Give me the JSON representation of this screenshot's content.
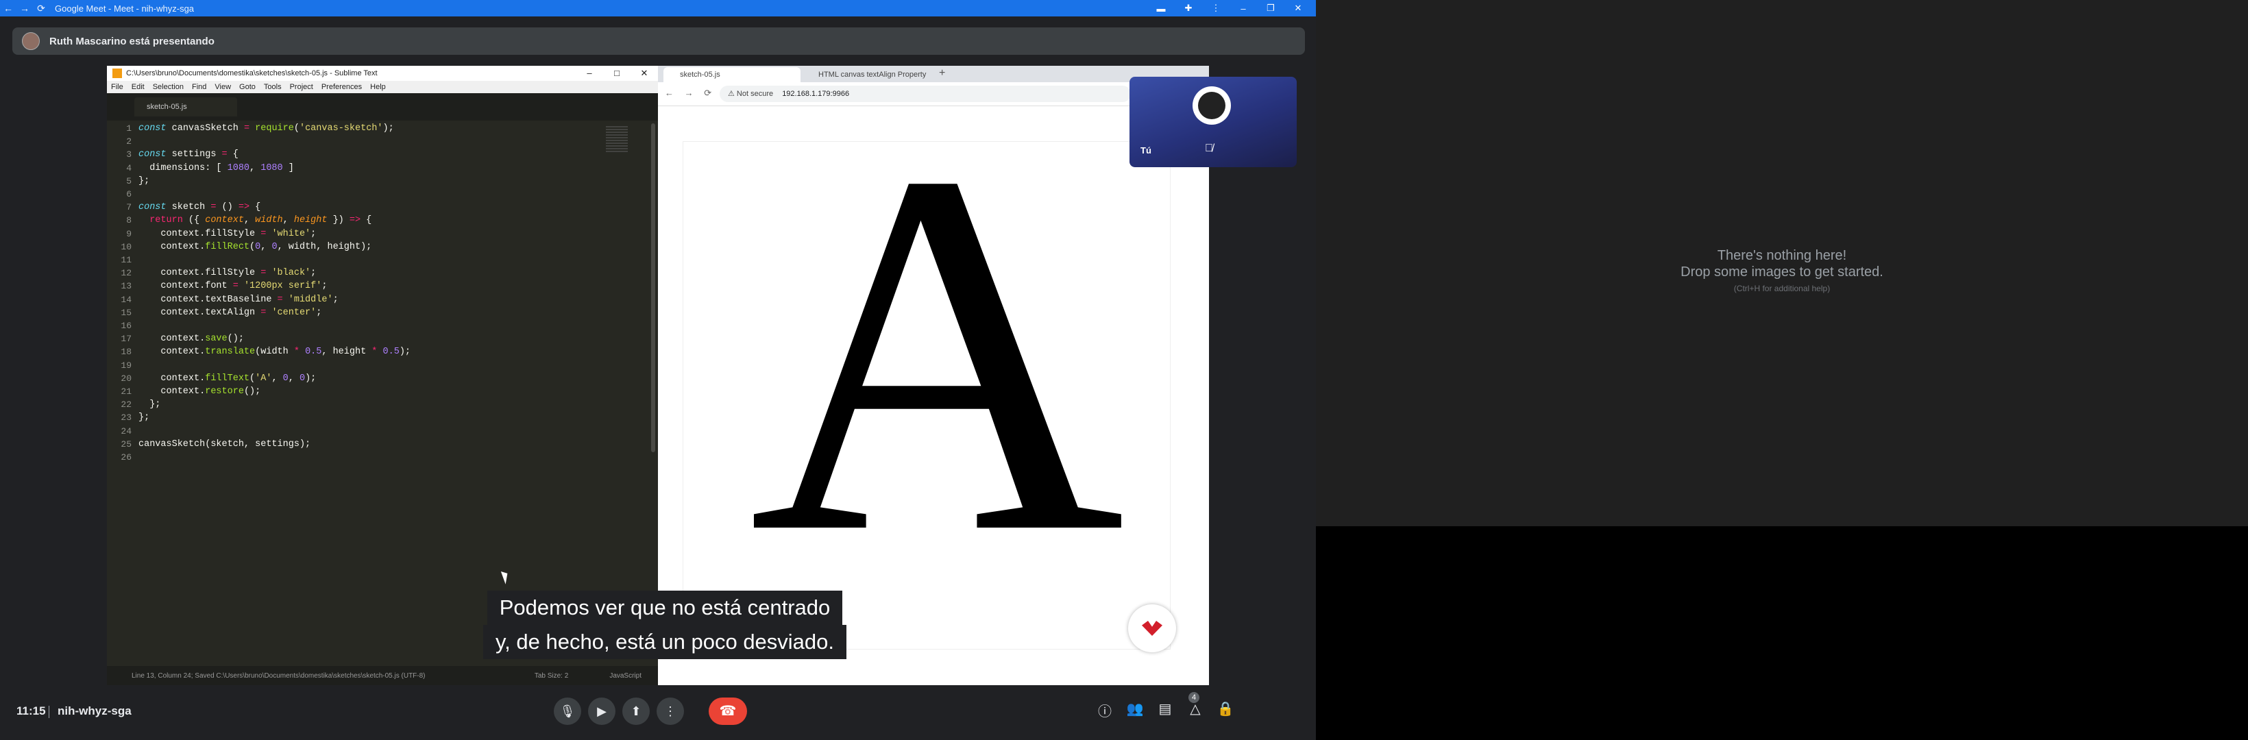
{
  "meet": {
    "window_title": "Google Meet - Meet - nih-whyz-sga",
    "presenting_text": "Ruth Mascarino está presentando",
    "time": "11:15",
    "meeting_code": "nih-whyz-sga",
    "self_label": "Tú",
    "participants_count": "4",
    "captions": [
      "Podemos ver que no está centrado",
      "y, de hecho, está un poco desviado."
    ],
    "accent_color": "#1a73e8",
    "end_call_color": "#ea4335"
  },
  "sublime": {
    "title": "C:\\Users\\bruno\\Documents\\domestika\\sketches\\sketch-05.js - Sublime Text",
    "menu": [
      "File",
      "Edit",
      "Selection",
      "Find",
      "View",
      "Goto",
      "Tools",
      "Project",
      "Preferences",
      "Help"
    ],
    "tab": "sketch-05.js",
    "status_left": "Line 13, Column 24; Saved C:\\Users\\bruno\\Documents\\domestika\\sketches\\sketch-05.js (UTF-8)",
    "status_tab": "Tab Size: 2",
    "status_syntax": "JavaScript",
    "code_lines": [
      "const canvasSketch = require('canvas-sketch');",
      "",
      "const settings = {",
      "  dimensions: [ 1080, 1080 ]",
      "};",
      "",
      "const sketch = () => {",
      "  return ({ context, width, height }) => {",
      "    context.fillStyle = 'white';",
      "    context.fillRect(0, 0, width, height);",
      "",
      "    context.fillStyle = 'black';",
      "    context.font = '1200px serif';",
      "    context.textBaseline = 'middle';",
      "    context.textAlign = 'center';",
      "",
      "    context.save();",
      "    context.translate(width * 0.5, height * 0.5);",
      "",
      "    context.fillText('A', 0, 0);",
      "    context.restore();",
      "  };",
      "};",
      "",
      "canvasSketch(sketch, settings);",
      ""
    ]
  },
  "chrome": {
    "tab1": "sketch-05.js",
    "tab2": "HTML canvas textAlign Property",
    "security": "Not secure",
    "url": "192.168.1.179:9966",
    "canvas_letter": "A"
  },
  "viewer": {
    "line1": "There's nothing here!",
    "line2": "Drop some images to get started.",
    "line3": "(Ctrl+H for additional help)"
  }
}
